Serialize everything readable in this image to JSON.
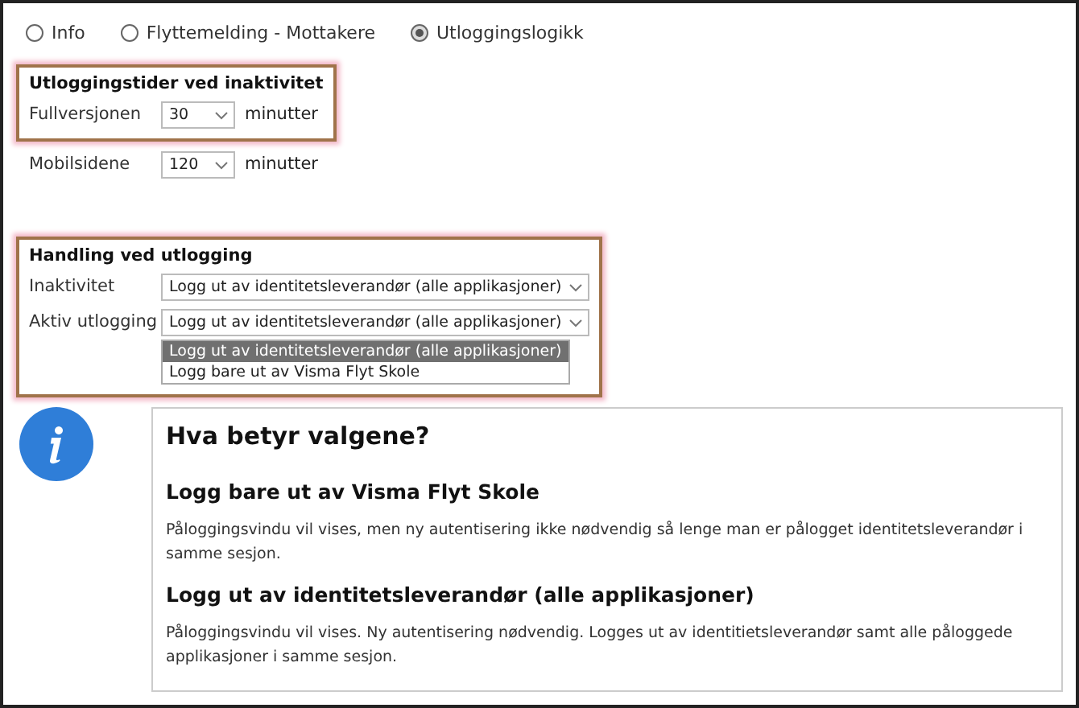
{
  "tabs": [
    {
      "label": "Info",
      "selected": false
    },
    {
      "label": "Flyttemelding - Mottakere",
      "selected": false
    },
    {
      "label": "Utloggingslogikk",
      "selected": true
    }
  ],
  "blocks": [
    {
      "title": "Utloggingstider ved inaktivitet",
      "highlighted": true,
      "rows": [
        {
          "kind": "short",
          "label": "Fullversjonen",
          "value": "30",
          "unit": "minutter"
        }
      ]
    },
    {
      "highlighted": false,
      "rows": [
        {
          "kind": "short",
          "label": "Mobilsidene",
          "value": "120",
          "unit": "minutter"
        }
      ]
    },
    {
      "title": "Handling ved utlogging",
      "highlighted": true,
      "rows": [
        {
          "kind": "long",
          "label": "Inaktivitet",
          "value": "Logg ut av identitetsleverandør (alle applikasjoner)"
        },
        {
          "kind": "long",
          "label": "Aktiv utlogging",
          "value": "Logg ut av identitetsleverandør (alle applikasjoner)",
          "options": [
            {
              "label": "Logg ut av identitetsleverandør (alle applikasjoner)",
              "selected": true
            },
            {
              "label": "Logg bare ut av Visma Flyt Skole",
              "selected": false
            }
          ]
        }
      ]
    }
  ],
  "info": {
    "title": "Hva betyr valgene?",
    "sections": [
      {
        "heading": "Logg bare ut av Visma Flyt Skole",
        "text": "Påloggingsvindu vil vises, men ny autentisering ikke nødvendig så lenge man er pålogget identitetsleverandør i samme sesjon."
      },
      {
        "heading": "Logg ut av identitetsleverandør (alle applikasjoner)",
        "text": "Påloggingsvindu vil vises. Ny autentisering nødvendig. Logges ut av identitietsleverandør samt alle påloggede applikasjoner i samme sesjon."
      }
    ]
  }
}
